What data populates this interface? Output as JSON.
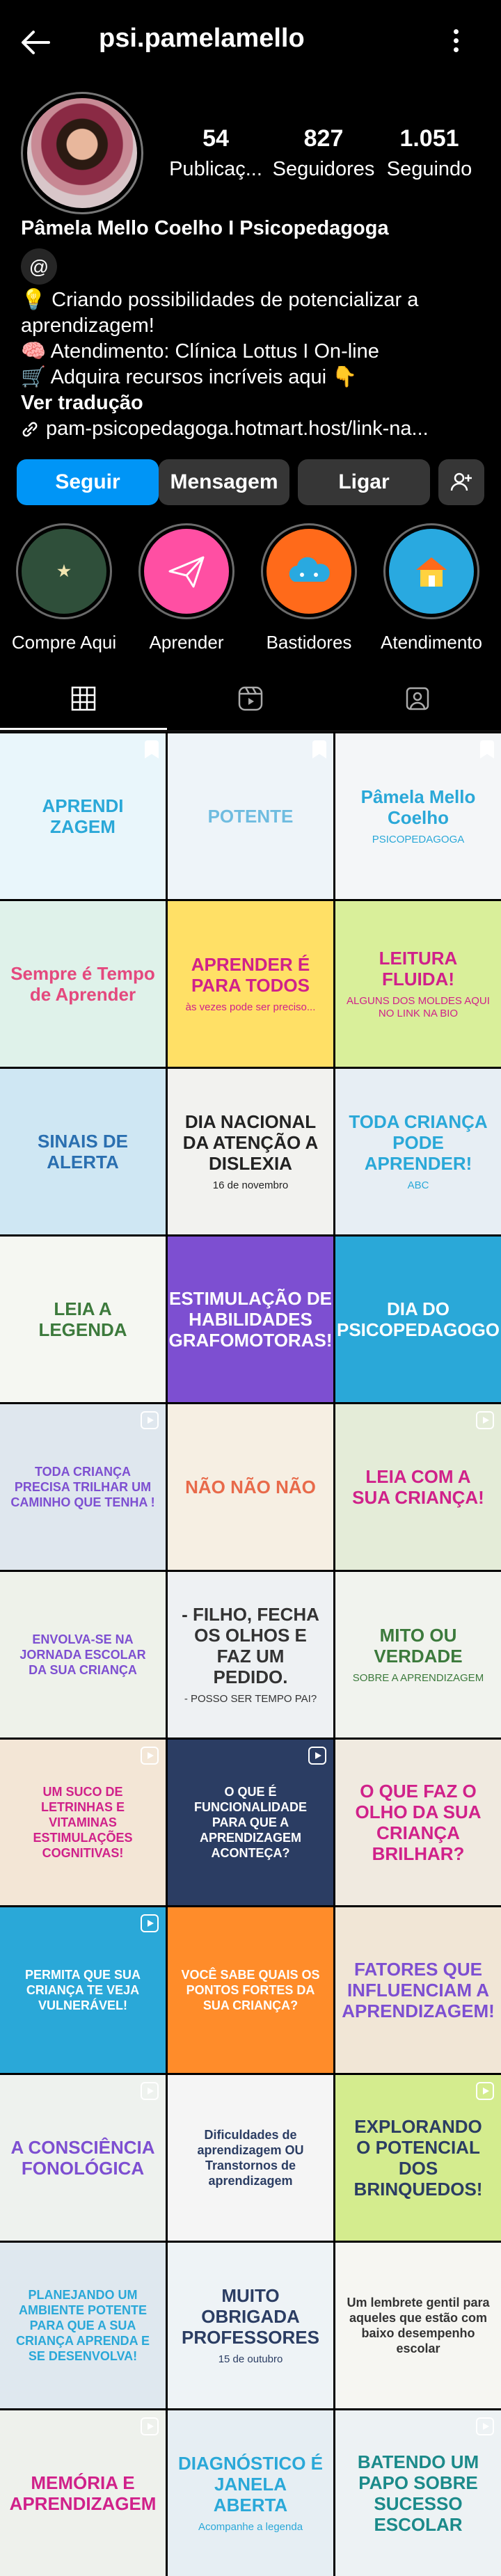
{
  "header": {
    "username": "psi.pamelamello"
  },
  "stats": [
    {
      "value": "54",
      "label": "Publicaç..."
    },
    {
      "value": "827",
      "label": "Seguidores"
    },
    {
      "value": "1.051",
      "label": "Seguindo"
    }
  ],
  "bio": {
    "name": "Pâmela Mello Coelho I Psicopedagoga",
    "line1": "💡 Criando possibilidades de potencializar a aprendizagem!",
    "line2": "🧠 Atendimento: Clínica Lottus I On-line",
    "line3": "🛒 Adquira recursos incríveis aqui 👇",
    "translate": "Ver tradução",
    "link": "pam-psicopedagoga.hotmart.host/link-na..."
  },
  "buttons": {
    "follow": "Seguir",
    "message": "Mensagem",
    "call": "Ligar"
  },
  "highlights": [
    {
      "label": "Compre Aqui",
      "color": "#2f4f3a"
    },
    {
      "label": "Aprender",
      "color": "#ff4fa3"
    },
    {
      "label": "Bastidores",
      "color": "#ff6a1a"
    },
    {
      "label": "Atendimento",
      "color": "#29a9e0"
    }
  ],
  "posts": [
    {
      "title": "APRENDI ZAGEM",
      "sub": "",
      "bg": "#e9f6fb",
      "fg": "#2aa8d8"
    },
    {
      "title": "POTENTE",
      "sub": "",
      "bg": "#eef4f9",
      "fg": "#6fbce0"
    },
    {
      "title": "Pâmela Mello Coelho",
      "sub": "PSICOPEDAGOGA",
      "bg": "#f4f6f8",
      "fg": "#2aa8d8"
    },
    {
      "title": "Sempre é Tempo de Aprender",
      "sub": "",
      "bg": "#dff2ea",
      "fg": "#e4497e"
    },
    {
      "title": "APRENDER É PARA TODOS",
      "sub": "às vezes pode ser preciso...",
      "bg": "#ffe066",
      "fg": "#d0218a"
    },
    {
      "title": "LEITURA FLUIDA!",
      "sub": "ALGUNS DOS MOLDES AQUI NO LINK NA BIO",
      "bg": "#d9ef9a",
      "fg": "#d0218a"
    },
    {
      "title": "SINAIS DE ALERTA",
      "sub": "",
      "bg": "#cfe7f3",
      "fg": "#2a6fb0"
    },
    {
      "title": "DIA NACIONAL DA ATENÇÃO A DISLEXIA",
      "sub": "16 de novembro",
      "bg": "#f2f2ef",
      "fg": "#222"
    },
    {
      "title": "TODA CRIANÇA PODE APRENDER!",
      "sub": "ABC",
      "bg": "#e7eef4",
      "fg": "#2aa8d8"
    },
    {
      "title": "LEIA A LEGENDA",
      "sub": "",
      "bg": "#f5f7f2",
      "fg": "#3c7a3c"
    },
    {
      "title": "ESTIMULAÇÃO DE HABILIDADES GRAFOMOTORAS!",
      "sub": "",
      "bg": "#7d4fd1",
      "fg": "#ffffff"
    },
    {
      "title": "DIA DO PSICOPEDAGOGO",
      "sub": "",
      "bg": "#2aa8d8",
      "fg": "#ffffff"
    },
    {
      "title": "TODA CRIANÇA PRECISA TRILHAR UM CAMINHO QUE TENHA !",
      "sub": "",
      "bg": "#dfe7ee",
      "fg": "#7d4fd1"
    },
    {
      "title": "NÃO NÃO NÃO",
      "sub": "",
      "bg": "#f6efe3",
      "fg": "#e86a4a"
    },
    {
      "title": "LEIA COM A SUA CRIANÇA!",
      "sub": "",
      "bg": "#e4ecd8",
      "fg": "#d0218a"
    },
    {
      "title": "ENVOLVA-SE NA JORNADA ESCOLAR DA SUA CRIANÇA",
      "sub": "",
      "bg": "#eef2ea",
      "fg": "#7d4fd1"
    },
    {
      "title": "- FILHO, FECHA OS OLHOS E FAZ UM PEDIDO.",
      "sub": "- POSSO SER TEMPO PAI?",
      "bg": "#eef1f3",
      "fg": "#333"
    },
    {
      "title": "MITO OU VERDADE",
      "sub": "SOBRE A APRENDIZAGEM",
      "bg": "#f1f3ee",
      "fg": "#3c7a3c"
    },
    {
      "title": "UM SUCO DE LETRINHAS E VITAMINAS ESTIMULAÇÕES COGNITIVAS!",
      "sub": "",
      "bg": "#f3e6d6",
      "fg": "#d0218a"
    },
    {
      "title": "O QUE É FUNCIONALIDADE PARA QUE A APRENDIZAGEM ACONTEÇA?",
      "sub": "",
      "bg": "#2b3d63",
      "fg": "#ffffff"
    },
    {
      "title": "O QUE FAZ O OLHO DA SUA CRIANÇA BRILHAR?",
      "sub": "",
      "bg": "#f0eae0",
      "fg": "#d0218a"
    },
    {
      "title": "PERMITA QUE SUA CRIANÇA TE VEJA VULNERÁVEL!",
      "sub": "",
      "bg": "#2aa8d8",
      "fg": "#ffffff"
    },
    {
      "title": "VOCÊ SABE QUAIS OS PONTOS FORTES DA SUA CRIANÇA?",
      "sub": "",
      "bg": "#ff8c2a",
      "fg": "#ffffff"
    },
    {
      "title": "FATORES QUE INFLUENCIAM A APRENDIZAGEM!",
      "sub": "",
      "bg": "#f1e6d6",
      "fg": "#7d4fd1"
    },
    {
      "title": "A CONSCIÊNCIA FONOLÓGICA",
      "sub": "",
      "bg": "#eef2ee",
      "fg": "#7d4fd1"
    },
    {
      "title": "Dificuldades de aprendizagem OU Transtornos de aprendizagem",
      "sub": "",
      "bg": "#f5f5f5",
      "fg": "#2b3d63"
    },
    {
      "title": "EXPLORANDO O POTENCIAL DOS BRINQUEDOS!",
      "sub": "",
      "bg": "#d4ec8e",
      "fg": "#2b3d63"
    },
    {
      "title": "PLANEJANDO UM AMBIENTE POTENTE PARA QUE A SUA CRIANÇA APRENDA E SE DESENVOLVA!",
      "sub": "",
      "bg": "#dfe8ef",
      "fg": "#2aa8d8"
    },
    {
      "title": "MUITO OBRIGADA PROFESSORES",
      "sub": "15 de outubro",
      "bg": "#eef3f6",
      "fg": "#2b3d63"
    },
    {
      "title": "Um lembrete gentil para aqueles que estão com baixo desempenho escolar",
      "sub": "",
      "bg": "#f6f6f2",
      "fg": "#333"
    },
    {
      "title": "MEMÓRIA E APRENDIZAGEM",
      "sub": "",
      "bg": "#eef1ec",
      "fg": "#d0218a"
    },
    {
      "title": "DIAGNÓSTICO É JANELA ABERTA",
      "sub": "Acompanhe a legenda",
      "bg": "#e6eef3",
      "fg": "#2aa8d8"
    },
    {
      "title": "BATENDO UM PAPO SOBRE SUCESSO ESCOLAR",
      "sub": "",
      "bg": "#edf2f4",
      "fg": "#1b8a8a"
    }
  ]
}
